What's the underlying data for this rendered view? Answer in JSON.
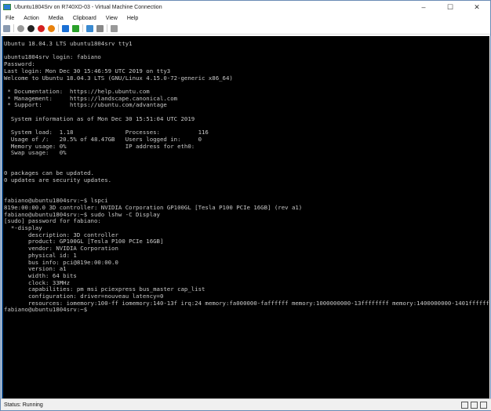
{
  "window": {
    "title": "Ubuntu1804Srv on R740XD-03 - Virtual Machine Connection",
    "minimize": "–",
    "maximize": "☐",
    "close": "✕"
  },
  "menu": [
    "File",
    "Action",
    "Media",
    "Clipboard",
    "View",
    "Help"
  ],
  "toolbar": [
    {
      "name": "ctrl-alt-del-icon",
      "color": "#8a9ab0"
    },
    {
      "name": "start-icon",
      "color": "#9a9a9a"
    },
    {
      "name": "turn-off-icon",
      "color": "#222222"
    },
    {
      "name": "shutdown-icon",
      "color": "#d42020"
    },
    {
      "name": "save-icon",
      "color": "#e8820c"
    },
    {
      "name": "pause-icon",
      "color": "#1a6fd4"
    },
    {
      "name": "reset-icon",
      "color": "#2aa02a"
    },
    {
      "name": "checkpoint-icon",
      "color": "#3a8ad0"
    },
    {
      "name": "revert-icon",
      "color": "#888888"
    },
    {
      "name": "enhanced-session-icon",
      "color": "#999999"
    }
  ],
  "terminal": {
    "lines": [
      "Ubuntu 18.04.3 LTS ubuntu1804srv tty1",
      "",
      "ubuntu1804srv login: fabiano",
      "Password:",
      "Last login: Mon Dec 30 15:46:59 UTC 2019 on tty3",
      "Welcome to Ubuntu 18.04.3 LTS (GNU/Linux 4.15.0-72-generic x86_64)",
      "",
      " * Documentation:  https://help.ubuntu.com",
      " * Management:     https://landscape.canonical.com",
      " * Support:        https://ubuntu.com/advantage",
      "",
      "  System information as of Mon Dec 30 15:51:04 UTC 2019",
      "",
      "  System load:  1.18               Processes:           116",
      "  Usage of /:   20.5% of 48.47GB   Users logged in:     0",
      "  Memory usage: 0%                 IP address for eth0:",
      "  Swap usage:   0%",
      "",
      "",
      "0 packages can be updated.",
      "0 updates are security updates.",
      "",
      "",
      "fabiano@ubuntu1804srv:~$ lspci",
      "819e:00:00.0 3D controller: NVIDIA Corporation GP100GL [Tesla P100 PCIe 16GB] (rev a1)",
      "fabiano@ubuntu1804srv:~$ sudo lshw -C Display",
      "[sudo] password for fabiano:",
      "  *-display",
      "       description: 3D controller",
      "       product: GP100GL [Tesla P100 PCIe 16GB]",
      "       vendor: NVIDIA Corporation",
      "       physical id: 1",
      "       bus info: pci@819e:00:00.0",
      "       version: a1",
      "       width: 64 bits",
      "       clock: 33MHz",
      "       capabilities: pm msi pciexpress bus_master cap_list",
      "       configuration: driver=nouveau latency=0",
      "       resources: iomemory:100-ff iomemory:140-13f irq:24 memory:fa000000-faffffff memory:1000000000-13ffffffff memory:1400000000-1401ffffff",
      "fabiano@ubuntu1804srv:~$"
    ]
  },
  "status": {
    "text": "Status: Running"
  }
}
